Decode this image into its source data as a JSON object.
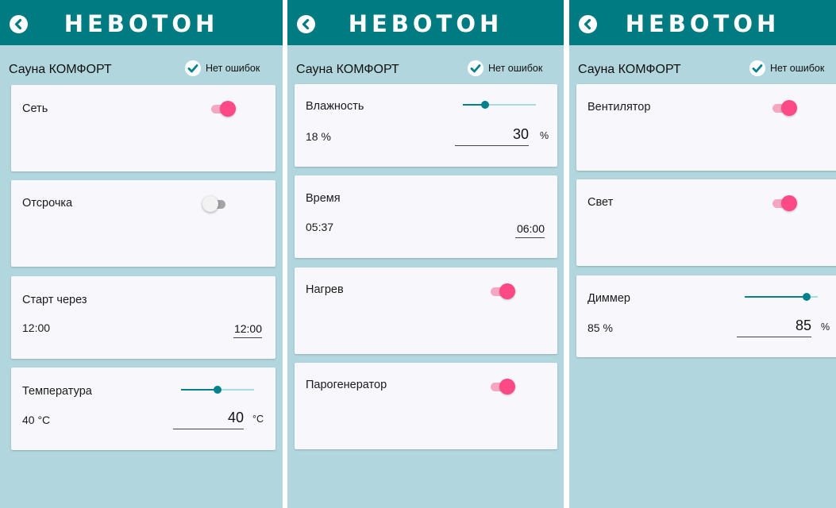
{
  "app": {
    "brand": "НЕВОТОН",
    "title": "Сауна КОМФОРТ",
    "status": "Нет ошибок"
  },
  "colors": {
    "header": "#007b82",
    "background": "#b2d6de",
    "card": "#f8f8fc",
    "accent": "#fd4985",
    "slider": "#00818b"
  },
  "screen1": {
    "network": {
      "label": "Сеть",
      "on": true
    },
    "delay": {
      "label": "Отсрочка",
      "on": false
    },
    "start": {
      "label": "Старт через",
      "value": "12:00",
      "input": "12:00"
    },
    "temperature": {
      "label": "Температура",
      "current": "40 °C",
      "setpoint": "40",
      "unit": "°C",
      "level": 0.5
    }
  },
  "screen2": {
    "humidity": {
      "label": "Влажность",
      "current": "18 %",
      "setpoint": "30",
      "unit": "%",
      "level": 0.3
    },
    "time": {
      "label": "Время",
      "value": "05:37",
      "input": "06:00"
    },
    "heating": {
      "label": "Нагрев",
      "on": true
    },
    "steam": {
      "label": "Парогенератор",
      "on": true
    }
  },
  "screen3": {
    "fan": {
      "label": "Вентилятор",
      "on": true
    },
    "light": {
      "label": "Свет",
      "on": true
    },
    "dimmer": {
      "label": "Диммер",
      "current": "85 %",
      "setpoint": "85",
      "unit": "%",
      "level": 0.85
    }
  }
}
